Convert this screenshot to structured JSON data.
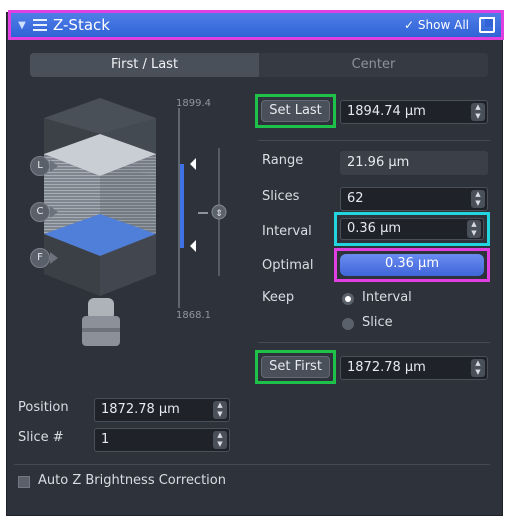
{
  "header": {
    "title": "Z-Stack",
    "show_all": "✓ Show All",
    "icons": {
      "collapse": "caret-down-icon",
      "list": "list-icon",
      "external": "external-window-icon"
    }
  },
  "tabs": [
    {
      "label": "First / Last",
      "active": true
    },
    {
      "label": "Center",
      "active": false
    }
  ],
  "viz": {
    "top_scale": "1899.4",
    "bottom_scale": "1868.1",
    "markers": [
      {
        "letter": "L"
      },
      {
        "letter": "C"
      },
      {
        "letter": "F"
      }
    ]
  },
  "set_last": {
    "label": "Set Last",
    "value": "1894.74 µm"
  },
  "range": {
    "label": "Range",
    "value": "21.96 µm"
  },
  "slices": {
    "label": "Slices",
    "value": "62"
  },
  "interval": {
    "label": "Interval",
    "value": "0.36 µm"
  },
  "optimal": {
    "label": "Optimal",
    "value": "0.36 µm"
  },
  "keep": {
    "label": "Keep",
    "options": [
      {
        "label": "Interval",
        "selected": true
      },
      {
        "label": "Slice",
        "selected": false
      }
    ]
  },
  "set_first": {
    "label": "Set First",
    "value": "1872.78 µm"
  },
  "position": {
    "label": "Position",
    "value": "1872.78 µm"
  },
  "slice_num": {
    "label": "Slice #",
    "value": "1"
  },
  "auto_z": {
    "label": "Auto Z Brightness Correction",
    "checked": false
  },
  "colors": {
    "accent": "#3163d6",
    "highlight_green": "#1ec24a",
    "highlight_cyan": "#22d6e0",
    "highlight_magenta": "#e040e0",
    "panel_bg": "#2e333b"
  }
}
